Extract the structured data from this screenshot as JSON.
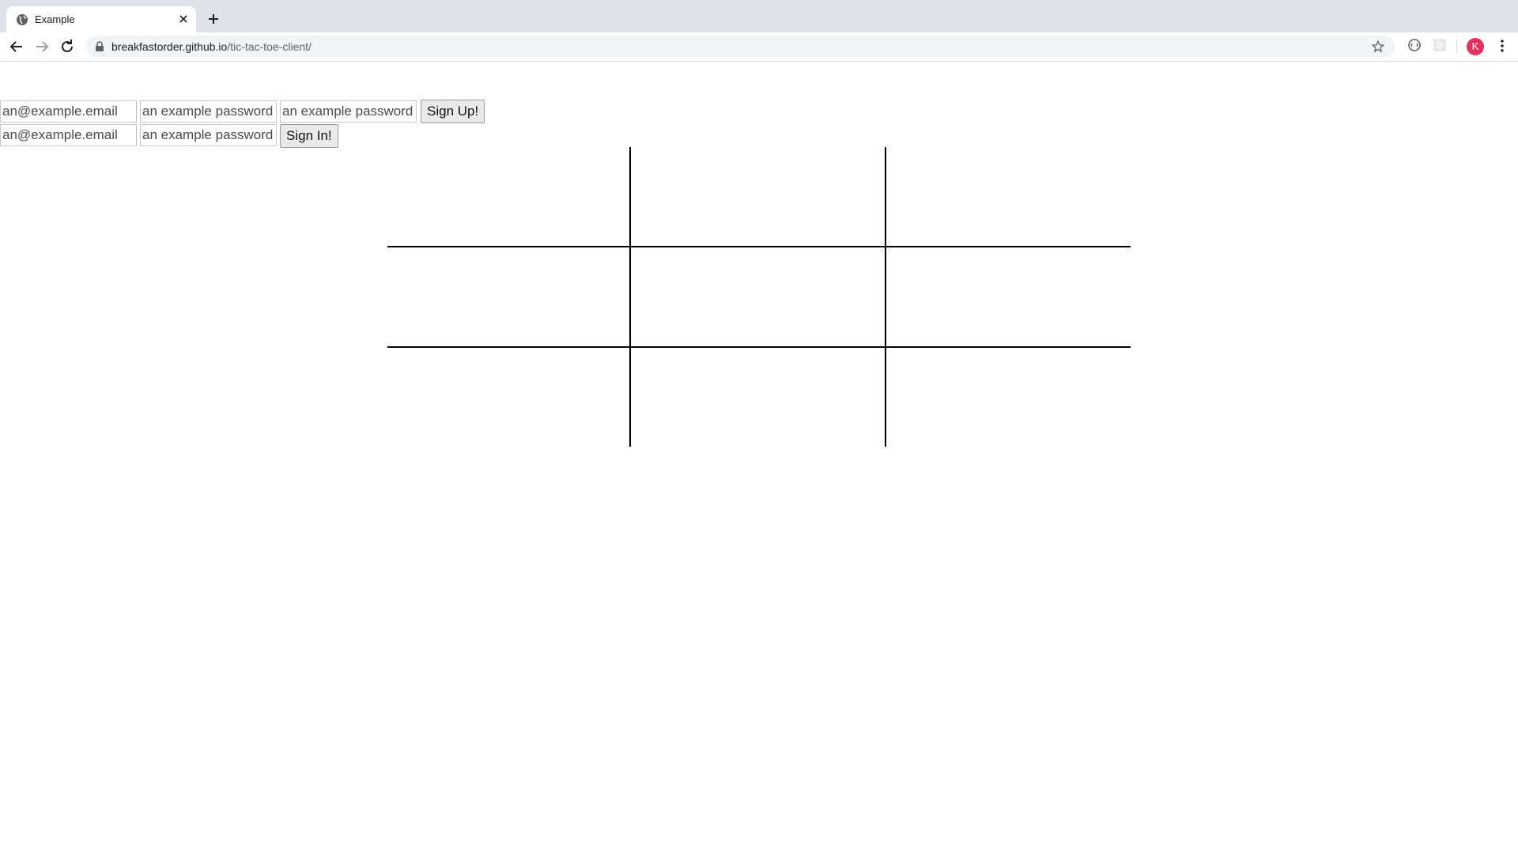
{
  "browser": {
    "tab_title": "Example",
    "url_host": "breakfastorder.github.io",
    "url_path": "/tic-tac-toe-client/",
    "profile_initial": "K",
    "profile_color": "#e0315f"
  },
  "sign_up": {
    "email_placeholder": "an@example.email",
    "password_placeholder": "an example password",
    "password_confirm_placeholder": "an example password",
    "button_label": "Sign Up!"
  },
  "sign_in": {
    "email_placeholder": "an@example.email",
    "password_placeholder": "an example password",
    "button_label": "Sign In!"
  },
  "board": {
    "cells": [
      "",
      "",
      "",
      "",
      "",
      "",
      "",
      "",
      ""
    ]
  }
}
